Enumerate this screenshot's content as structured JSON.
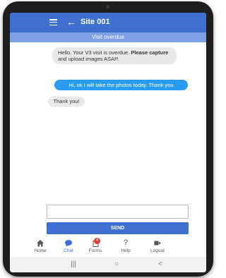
{
  "appbar": {
    "title": "Site 001",
    "back_glyph": "←"
  },
  "subbar": {
    "text": "Visit overdue"
  },
  "messages": [
    {
      "direction": "in",
      "text_plain": "Hello. Your V3 visit is overdue. ",
      "text_bold": "Please capture",
      "text_tail": "and upload images ASAP."
    },
    {
      "direction": "out",
      "text": "Hi, ok I will take the photos today. Thank you"
    },
    {
      "direction": "in",
      "text": "Thank you!"
    }
  ],
  "composer": {
    "input_value": "",
    "send_label": "SEND"
  },
  "nav": {
    "items": [
      {
        "label": "Home",
        "icon": "home-icon"
      },
      {
        "label": "Chat",
        "icon": "chat-icon",
        "active": true
      },
      {
        "label": "Forms",
        "icon": "forms-icon",
        "badge": "4"
      },
      {
        "label": "Help",
        "icon": "help-icon",
        "glyph": "?"
      },
      {
        "label": "Logout",
        "icon": "logout-icon"
      }
    ]
  },
  "system_nav": {
    "recents_glyph": "|||",
    "home_glyph": "○",
    "back_glyph": "<"
  },
  "colors": {
    "primary": "#3f6fd1",
    "subbar": "#7d9fe4",
    "outgoing_bubble": "#2a9bf3",
    "incoming_bubble": "#e9e9e9",
    "badge": "#e53935"
  }
}
